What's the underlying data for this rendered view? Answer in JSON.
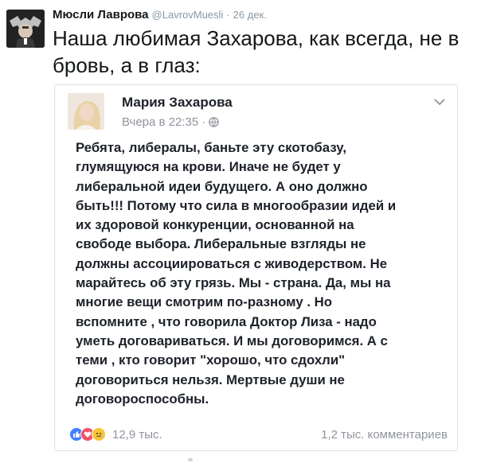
{
  "tweet": {
    "author_name": "Мюсли Лаврова",
    "author_handle": "@LavrovMuesli",
    "separator": "·",
    "date": "26 дек.",
    "text": "Наша любимая Захарова, как всегда, не в бровь, а в глаз:",
    "avatar_icon": "double-headed-eagle-portrait-icon"
  },
  "embedded_post": {
    "author_name": "Мария Захарова",
    "timestamp": "Вчера в 22:35",
    "separator": "·",
    "privacy_icon": "globe-icon",
    "menu_icon": "chevron-down-icon",
    "text": "Ребята, либералы, баньте эту скотобазу,\nглумящуюся на крови. Иначе не будет у\nлиберальной идеи будущего. А оно должно\nбыть!!!  Потому что сила в многообразии идей и\nих здоровой конкуренции, основанной  на\nсвободе выбора. Либеральные  взгляды  не\nдолжны ассоциироваться с живодерством. Не\nмарайтесь об эту грязь. Мы - страна. Да, мы на\nмногие вещи смотрим по-разному . Но\nвспомните , что говорила Доктор Лиза - надо\nуметь  договариваться. И мы договоримся. А с\nтеми , кто говорит \"хорошо, что сдохли\"\nдоговориться нельзя. Мертвые души не\nдоговороспособны.",
    "reactions": [
      "like-icon",
      "love-icon",
      "sad-icon"
    ],
    "reaction_count": "12,9 тыс.",
    "comment_count": "1,2 тыс. комментариев"
  },
  "colors": {
    "like": "#4080ff",
    "love": "#f25268",
    "sad": "#f7c537",
    "meta_gray": "#90949c",
    "card_border": "#dddfe2"
  }
}
